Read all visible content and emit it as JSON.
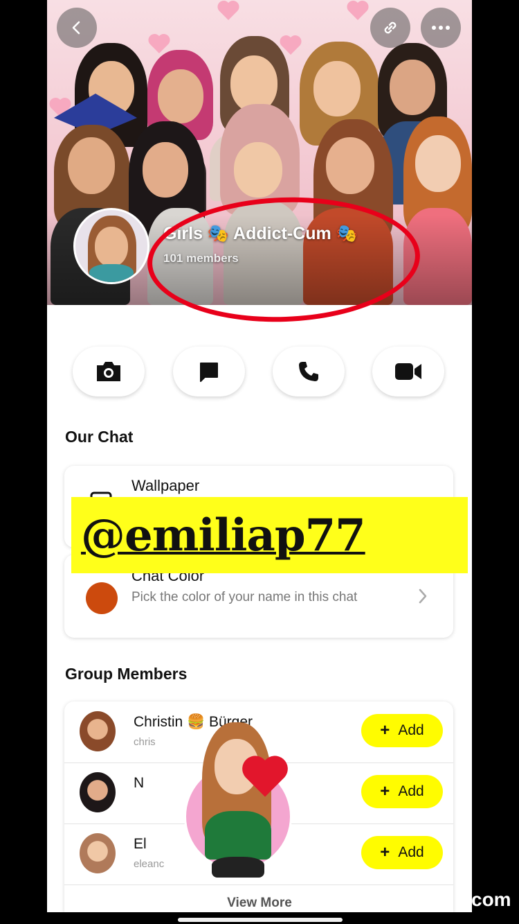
{
  "header": {
    "group_name": "Girls 🎭 Addict-Cum 🎭",
    "member_count": "101 members",
    "back_icon": "chevron-left-icon",
    "link_icon": "link-icon",
    "more_icon": "more-dots-icon"
  },
  "actions": [
    {
      "icon": "camera-icon"
    },
    {
      "icon": "chat-icon"
    },
    {
      "icon": "phone-icon"
    },
    {
      "icon": "video-icon"
    }
  ],
  "our_chat": {
    "title": "Our Chat",
    "wallpaper_label": "Wallpaper",
    "chat_color_label": "Chat Color",
    "chat_color_desc": "Pick the color of your name in this chat",
    "chat_color_value": "#cc4a0d"
  },
  "watermark": "@emiliap77",
  "group_members": {
    "title": "Group Members",
    "members": [
      {
        "name": "Christin 🍔 Bürger",
        "username": "chris",
        "add_label": "Add"
      },
      {
        "name": "N",
        "username": "",
        "add_label": "Add"
      },
      {
        "name": "El",
        "username": "eleanc",
        "add_label": "Add"
      }
    ],
    "view_more": "View More"
  },
  "corner_text": "com",
  "colors": {
    "accent_yellow": "#fffc00",
    "annotation_red": "#e8001a"
  }
}
